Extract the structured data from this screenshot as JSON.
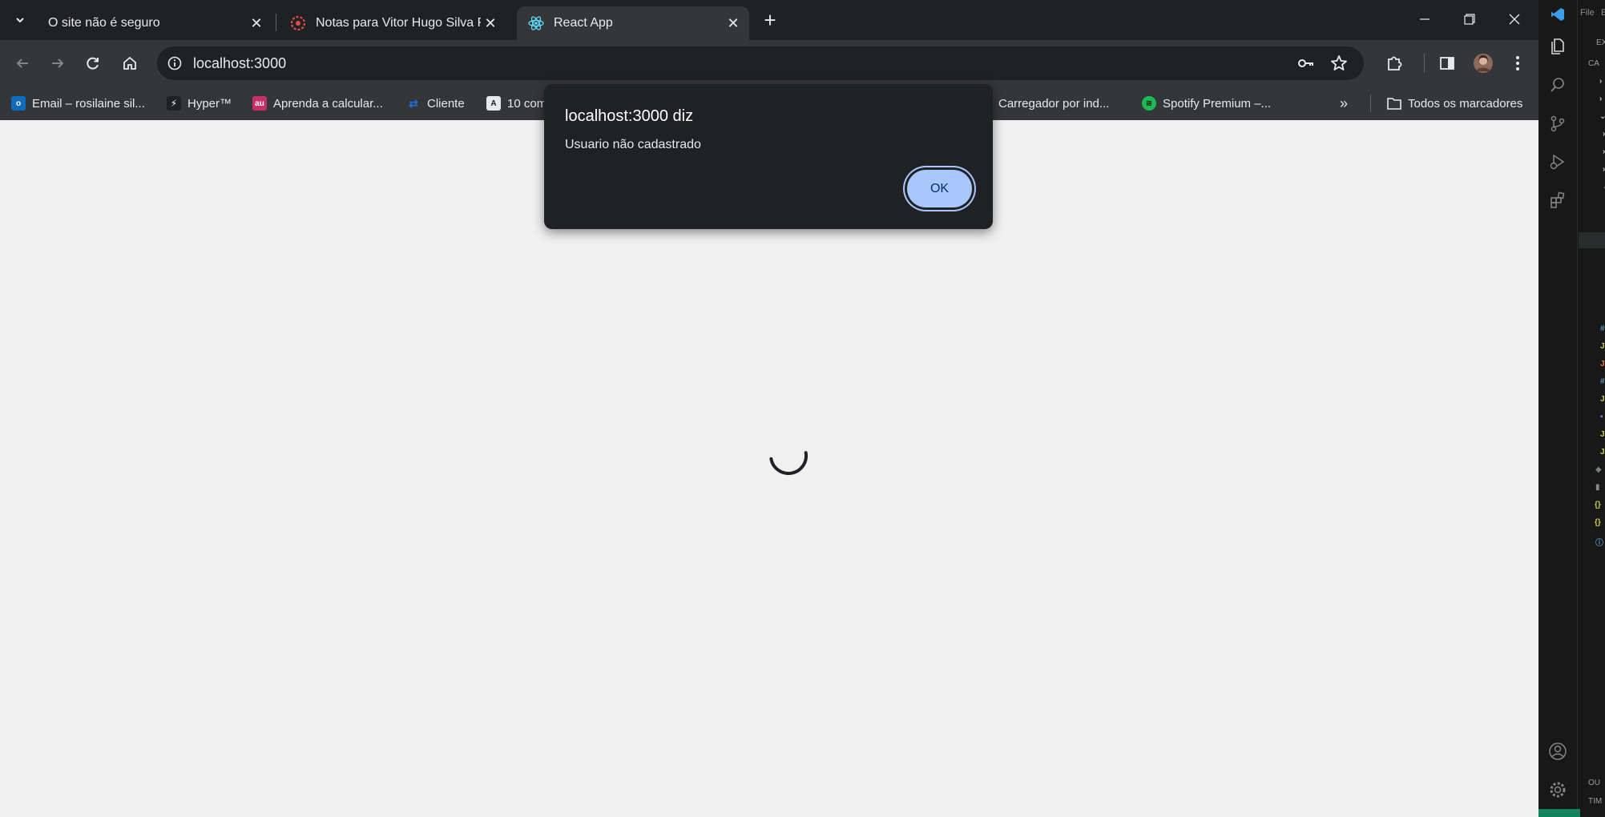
{
  "browser": {
    "tabs": [
      {
        "title": "O site não é seguro",
        "favicon": "warning-icon",
        "active": false
      },
      {
        "title": "Notas para Vitor Hugo Silva Ri",
        "favicon": "notes-icon",
        "active": false
      },
      {
        "title": "React App",
        "favicon": "react-icon",
        "active": true
      }
    ],
    "address": "localhost:3000",
    "bookmarks": [
      {
        "label": "Email – rosilaine sil...",
        "icon": "outlook-icon",
        "color": "#0f6cbd"
      },
      {
        "label": "Hyper™",
        "icon": "hyper-icon",
        "color": "#202124"
      },
      {
        "label": "Aprenda a calcular...",
        "icon": "au-icon",
        "color": "#c5306b"
      },
      {
        "label": "Cliente",
        "icon": "cliente-icon",
        "color": "#1a73e8"
      },
      {
        "label": "10 com",
        "icon": "angular-icon",
        "color": "#5f6368"
      },
      {
        "label": "Carregador por ind...",
        "icon": "bookmark-icon",
        "color": "#e8a33d"
      },
      {
        "label": "Spotify Premium –...",
        "icon": "spotify-icon",
        "color": "#1db954"
      }
    ],
    "all_bookmarks": "Todos os marcadores"
  },
  "alert": {
    "title": "localhost:3000 diz",
    "message": "Usuario não cadastrado",
    "ok_label": "OK"
  },
  "vscode": {
    "menu": [
      "File",
      "E"
    ],
    "explorer_header": "EXP",
    "section_1": "CA",
    "section_2": "OU",
    "section_3": "TIM"
  }
}
